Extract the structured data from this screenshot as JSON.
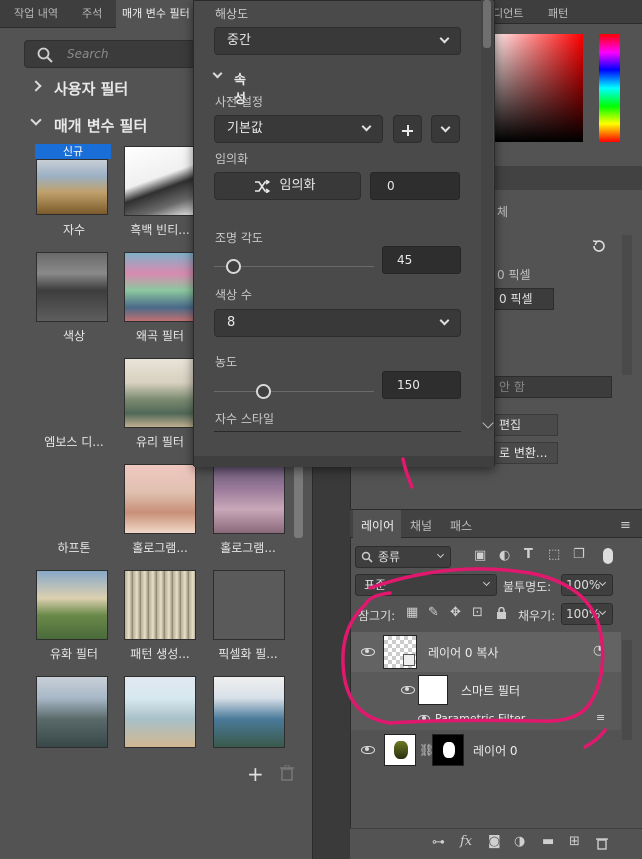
{
  "left_panel": {
    "tabs": [
      "작업 내역",
      "주석",
      "매개 변수 필터"
    ],
    "search_placeholder": "Search",
    "section_user": "사용자 필터",
    "section_param": "매개 변수 필터",
    "new_badge": "신규",
    "filters": [
      {
        "label": "자수"
      },
      {
        "label": "흑백 빈티..."
      },
      {
        "label": ""
      },
      {
        "label": "색상"
      },
      {
        "label": "왜곡 필터"
      },
      {
        "label": ""
      },
      {
        "label": "엠보스 디..."
      },
      {
        "label": "유리 필터"
      },
      {
        "label": ""
      },
      {
        "label": "하프톤"
      },
      {
        "label": "홀로그램..."
      },
      {
        "label": "홀로그램..."
      },
      {
        "label": "유화 필터"
      },
      {
        "label": "패턴 생성..."
      },
      {
        "label": "픽셀화 필..."
      }
    ],
    "add_icon": "+",
    "delete_icon": "trash-icon"
  },
  "popup": {
    "resolution_label": "해상도",
    "resolution_value": "중간",
    "properties_label": "속성",
    "preset_label": "사전 설정",
    "preset_value": "기본값",
    "random_label": "임의화",
    "random_button": "임의화",
    "random_value": "0",
    "light_angle_label": "조명 각도",
    "light_angle_value": "45",
    "light_angle_fraction": 0.12,
    "color_count_label": "색상 수",
    "color_count_value": "8",
    "density_label": "농도",
    "density_value": "150",
    "density_fraction": 0.31,
    "stitch_style_label": "자수 스타일"
  },
  "right_panel": {
    "tab_gradient": "디언트",
    "tab_pattern": "패턴",
    "prop_text": "체",
    "px1": "0 픽셀",
    "px2": "0 픽셀",
    "ahn_hap": "안 함",
    "edit": "편집",
    "convert": "로 변환..."
  },
  "layers": {
    "tabs": [
      "레이어",
      "채널",
      "패스"
    ],
    "kind": "종류",
    "blend": "표준",
    "opacity_label": "불투명도:",
    "opacity_value": "100%",
    "lock_label": "잠그기:",
    "fill_label": "채우기:",
    "fill_value": "100%",
    "rows": [
      {
        "name": "레이어 0 복사"
      },
      {
        "name": "스마트 필터"
      },
      {
        "name": "Parametric Filter"
      },
      {
        "name": "레이어 0"
      }
    ]
  }
}
